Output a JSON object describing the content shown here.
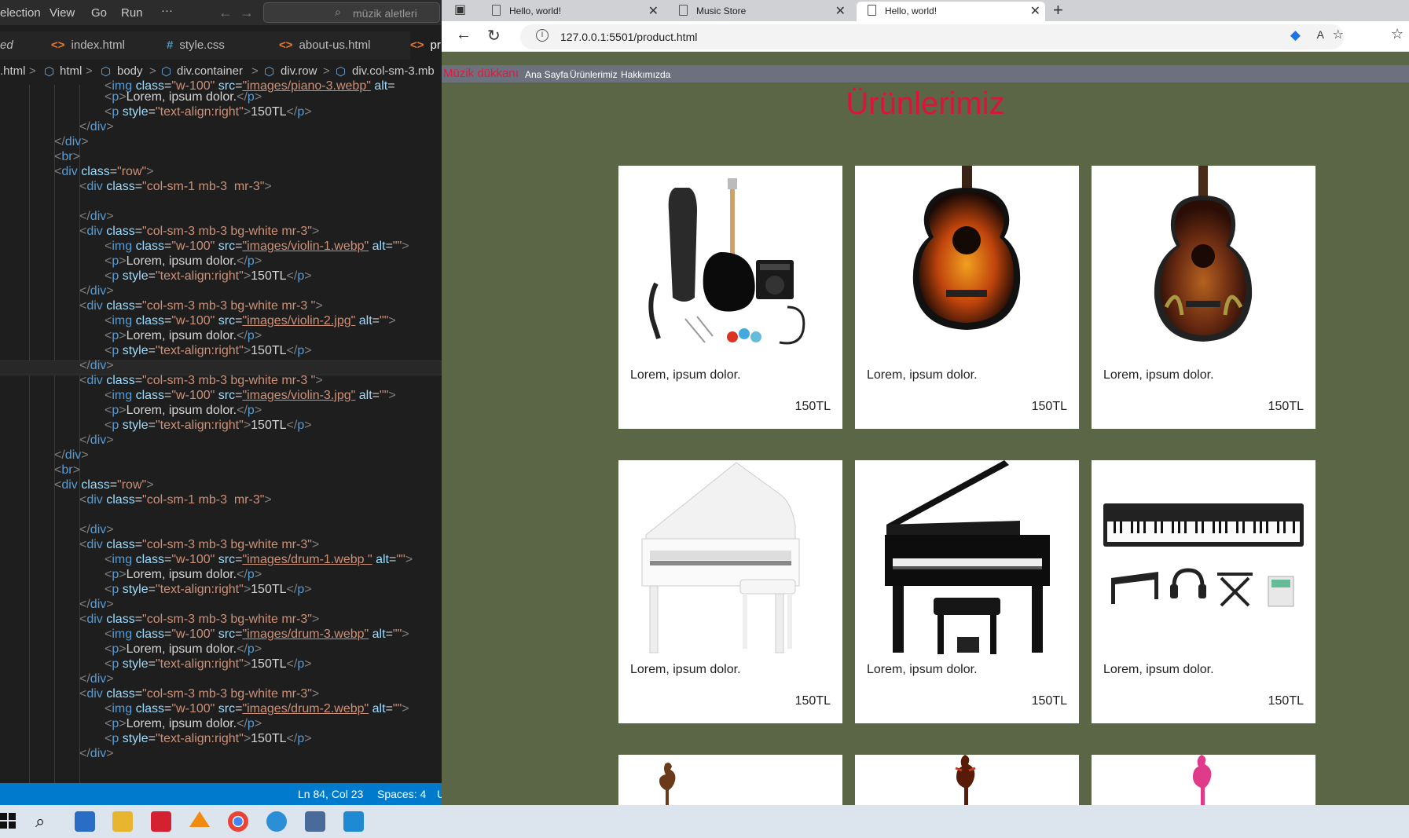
{
  "vscode": {
    "menu": [
      "election",
      "View",
      "Go",
      "Run",
      "···"
    ],
    "search_text": "müzik aletleri",
    "tabs": [
      {
        "icon": "",
        "label": "ed"
      },
      {
        "icon": "<>",
        "label": "index.html"
      },
      {
        "icon": "#",
        "label": "style.css"
      },
      {
        "icon": "<>",
        "label": "about-us.html"
      },
      {
        "icon": "<>",
        "label": "pr"
      }
    ],
    "breadcrumbs": [
      ".html",
      ">",
      "html",
      ">",
      "body",
      ">",
      "div.container",
      ">",
      "div.row",
      ">",
      "div.col-sm-3.mb"
    ],
    "status": {
      "position": "Ln 84, Col 23",
      "spaces": "Spaces: 4",
      "extra": "U"
    }
  },
  "browser": {
    "tabs": [
      {
        "title": "Hello, world!",
        "close": "✕"
      },
      {
        "title": "Music Store",
        "close": "✕"
      },
      {
        "title": "Hello, world!",
        "close": "✕"
      }
    ],
    "new_tab": "+",
    "url": "127.0.0.1:5501/product.html",
    "page": {
      "brand": "Müzik dükkanı",
      "nav": [
        "Ana Sayfa",
        "Ürünlerimiz",
        "Hakkımızda"
      ],
      "title": "Ürünlerimiz",
      "products": [
        {
          "desc": "Lorem, ipsum dolor.",
          "price": "150TL",
          "icon": "electric-guitar-kit"
        },
        {
          "desc": "Lorem, ipsum dolor.",
          "price": "150TL",
          "icon": "sunburst-acoustic-guitar"
        },
        {
          "desc": "Lorem, ipsum dolor.",
          "price": "150TL",
          "icon": "parlor-guitar"
        },
        {
          "desc": "Lorem, ipsum dolor.",
          "price": "150TL",
          "icon": "white-grand-piano"
        },
        {
          "desc": "Lorem, ipsum dolor.",
          "price": "150TL",
          "icon": "black-grand-piano"
        },
        {
          "desc": "Lorem, ipsum dolor.",
          "price": "150TL",
          "icon": "digital-keyboard-bundle"
        }
      ]
    }
  },
  "colors": {
    "page_bg": "#5b6647",
    "title": "#dc143c",
    "nav_bg": "#6c727d",
    "vscode_status": "#007acc"
  }
}
